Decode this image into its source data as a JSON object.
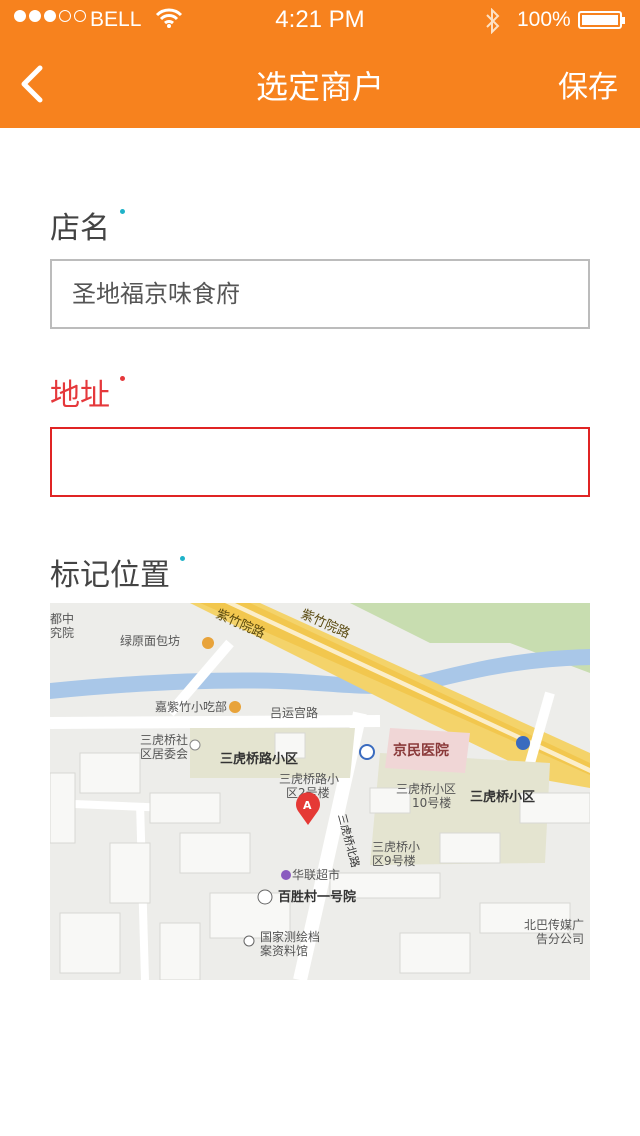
{
  "status_bar": {
    "carrier": "BELL",
    "time": "4:21 PM",
    "battery": "100%"
  },
  "nav": {
    "title": "选定商户",
    "save_label": "保存"
  },
  "form": {
    "store_name_label": "店名",
    "store_name_value": "圣地福京味食府",
    "address_label": "地址",
    "address_value": "",
    "location_label": "标记位置"
  },
  "map": {
    "labels": {
      "road_zizhuyuan_1": "紫竹院路",
      "road_zizhuyuan_2": "紫竹院路",
      "research_1": "都中",
      "research_2": "究院",
      "bakery": "绿原面包坊",
      "snack": "嘉紫竹小吃部",
      "lvyun": "吕运宫路",
      "community_office_1": "三虎桥社",
      "community_office_2": "区居委会",
      "sanhuqiao_road_community": "三虎桥路小区",
      "building2_1": "三虎桥路小",
      "building2_2": "区2号楼",
      "jingmin_hospital": "京民医院",
      "building10_1": "三虎桥小区",
      "building10_2": "10号楼",
      "sanhuqiao_community": "三虎桥小区",
      "sanhuqiao_north_road": "三虎桥北路",
      "building9_1": "三虎桥小",
      "building9_2": "区9号楼",
      "hualian": "华联超市",
      "baishengcun": "百胜村一号院",
      "archives_1": "国家测绘档",
      "archives_2": "案资料馆",
      "media_1": "北巴传媒广",
      "media_2": "告分公司",
      "marker": "A"
    }
  }
}
